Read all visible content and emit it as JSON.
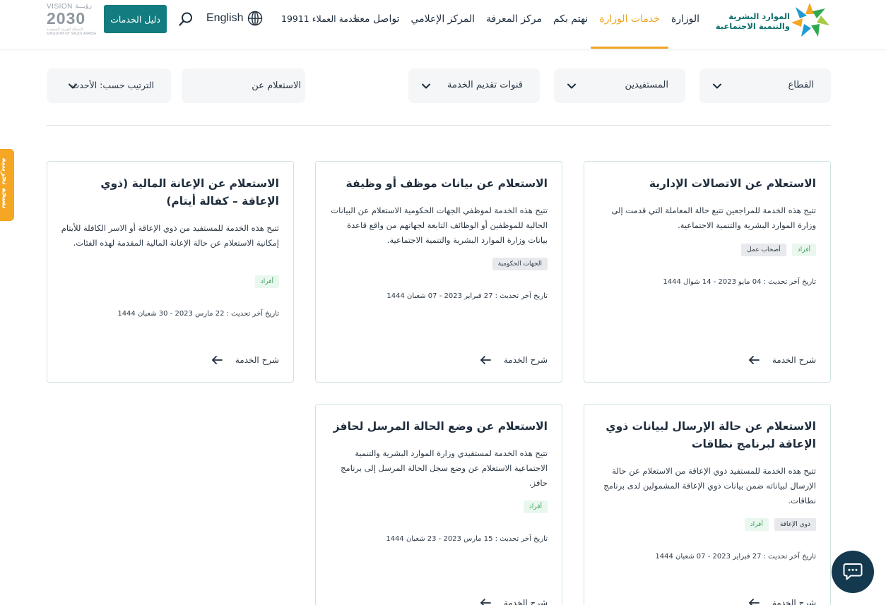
{
  "header": {
    "logo_line1": "الموارد البشرية",
    "logo_line2": "والتنمية الاجتماعية",
    "nav": [
      {
        "label": "الوزارة",
        "active": false
      },
      {
        "label": "خدمات الوزارة",
        "active": true
      },
      {
        "label": "نهتم بكم",
        "active": false
      },
      {
        "label": "مركز المعرفة",
        "active": false
      },
      {
        "label": "المركز الإعلامي",
        "active": false
      },
      {
        "label": "تواصل معنا",
        "active": false
      }
    ],
    "customer_service": "خدمة العملاء 19911",
    "language": "English",
    "guide_button": "دليل الخدمات",
    "vision": {
      "top": "VISION",
      "arabic": "رؤيـــة",
      "year": "2030",
      "sub1": "المملكة العربية السعودية",
      "sub2": "KINGDOM OF SAUDI ARABIA"
    }
  },
  "filters": {
    "sector": "القطاع",
    "beneficiaries": "المستفيدين",
    "channels": "قنوات تقديم الخدمة",
    "search_value": "الاستعلام عن",
    "sort": "الترتيب حسب: الأحدث"
  },
  "cards": [
    {
      "title": "الاستعلام عن الاتصالات الإدارية",
      "description": "تتيح هذه الخدمة للمراجعين تتبع حالة المعاملة التي قدمت إلى وزارة الموارد البشرية والتنمية الاجتماعية.",
      "tags": [
        {
          "label": "أفراد",
          "style": "green"
        },
        {
          "label": "أصحاب عمل",
          "style": "gray"
        }
      ],
      "date": "تاريخ آخر تحديث : 04 مايو 2023 - 14 شوال 1444",
      "link": "شرح الخدمة"
    },
    {
      "title": "الاستعلام عن بيانات موظف أو وظيفة",
      "description": "تتيح هذه الخدمة لموظفي الجهات الحكومية الاستعلام عن البيانات الحالية للموظفين أو الوظائف التابعة لجهاتهم من واقع قاعدة بيانات وزارة الموارد البشرية والتنمية الاجتماعية.",
      "tags": [
        {
          "label": "الجهات الحكومية",
          "style": "gray"
        }
      ],
      "date": "تاريخ آخر تحديث : 27 فبراير 2023 - 07 شعبان 1444",
      "link": "شرح الخدمة"
    },
    {
      "title": "الاستعلام عن الإعانة المالية (ذوي الإعاقة – كفالة أيتام)",
      "description": "تتيح هذه الخدمة للمستفيد من ذوي الإعاقة أو الاسر الكافلة للأيتام إمكانية الاستعلام عن حالة الإعانة المالية المقدمة لهذه الفئات.",
      "tags": [
        {
          "label": "أفراد",
          "style": "green"
        }
      ],
      "date": "تاريخ آخر تحديث : 22 مارس 2023 - 30 شعبان 1444",
      "link": "شرح الخدمة"
    },
    {
      "title": "الاستعلام عن حالة الإرسال لبيانات ذوي الإعاقة لبرنامج نطاقات",
      "description": "تتيح هذه الخدمة للمستفيد ذوي الإعاقة من الاستعلام عن حالة الإرسال لبياناته ضمن بيانات ذوي الإعاقة المشمولين لدى برنامج نطاقات.",
      "tags": [
        {
          "label": "ذوي الإعاقة",
          "style": "gray"
        },
        {
          "label": "أفراد",
          "style": "green"
        }
      ],
      "date": "تاريخ آخر تحديث : 27 فبراير 2023 - 07 شعبان 1444",
      "link": "شرح الخدمة"
    },
    {
      "title": "الاستعلام عن وضع الحالة المرسل لحافز",
      "description": "تتيح هذه الخدمة لمستفيدي وزارة الموارد البشرية والتنمية الاجتماعية الاستعلام عن وضع سجل الحالة المرسل إلى برنامج حافز.",
      "tags": [
        {
          "label": "أفراد",
          "style": "green"
        }
      ],
      "date": "تاريخ آخر تحديث : 15 مارس 2023 - 23 شعبان 1444",
      "link": "شرح الخدمة"
    }
  ],
  "side_tab": "نسخة تجريبية",
  "colors": {
    "accent_orange": "#f0a323",
    "primary_teal": "#137c80",
    "chat_navy": "#14394f"
  }
}
